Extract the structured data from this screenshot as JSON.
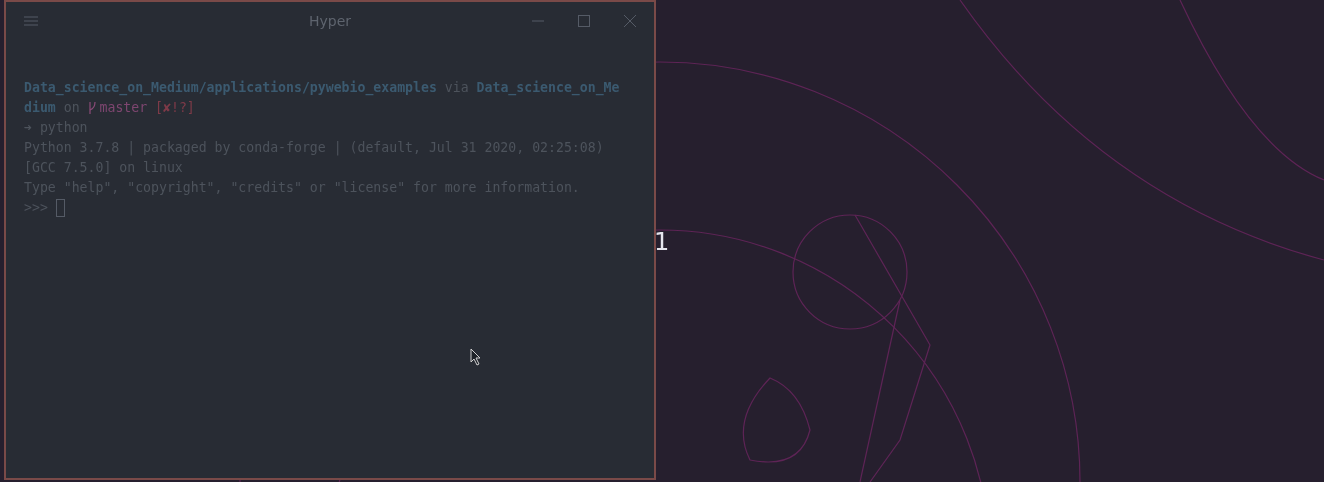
{
  "window": {
    "title": "Hyper"
  },
  "terminal": {
    "lines": [
      [
        {
          "kind": "path",
          "text": "Data_science_on_Medium/applications/pywebio_examples"
        },
        {
          "kind": "plain",
          "text": " via "
        },
        {
          "kind": "path",
          "text": "Data_science_on_Me"
        }
      ],
      [
        {
          "kind": "path",
          "text": "dium"
        },
        {
          "kind": "plain",
          "text": " on "
        },
        {
          "kind": "branch-icon"
        },
        {
          "kind": "branch",
          "text": "master "
        },
        {
          "kind": "status",
          "text": "[✘!?]"
        }
      ],
      [
        {
          "kind": "plain",
          "text": "➜ python"
        }
      ],
      [
        {
          "kind": "plain",
          "text": "Python 3.7.8 | packaged by conda-forge | (default, Jul 31 2020, 02:25:08)"
        }
      ],
      [
        {
          "kind": "plain",
          "text": "[GCC 7.5.0] on linux"
        }
      ],
      [
        {
          "kind": "plain",
          "text": "Type \"help\", \"copyright\", \"credits\" or \"license\" for more information."
        }
      ],
      [
        {
          "kind": "plain",
          "text": ">>> "
        },
        {
          "kind": "cursor"
        }
      ]
    ]
  },
  "desktop": {
    "label": "1"
  }
}
